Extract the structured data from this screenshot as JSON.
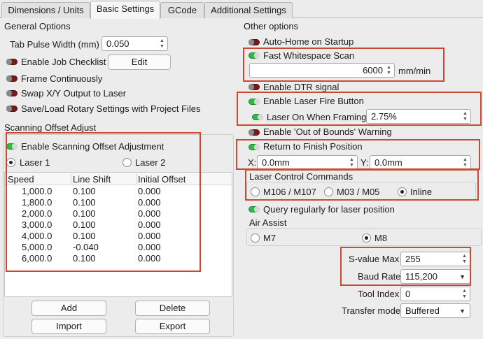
{
  "tabs": [
    {
      "label": "Dimensions / Units"
    },
    {
      "label": "Basic Settings"
    },
    {
      "label": "GCode"
    },
    {
      "label": "Additional Settings"
    }
  ],
  "general": {
    "title": "General Options",
    "tab_pulse_label": "Tab Pulse Width (mm)",
    "tab_pulse_value": "0.050",
    "job_checklist_label": "Enable Job Checklist",
    "edit_label": "Edit",
    "frame_continuously_label": "Frame Continuously",
    "swap_xy_label": "Swap X/Y Output to Laser",
    "rotary_label": "Save/Load Rotary Settings with Project Files"
  },
  "scanning": {
    "title": "Scanning Offset Adjust",
    "enable_label": "Enable Scanning Offset Adjustment",
    "laser1_label": "Laser 1",
    "laser2_label": "Laser 2",
    "columns": [
      "Speed",
      "Line Shift",
      "Initial Offset"
    ],
    "rows": [
      [
        "1,000.0",
        "0.100",
        "0.000"
      ],
      [
        "1,800.0",
        "0.100",
        "0.000"
      ],
      [
        "2,000.0",
        "0.100",
        "0.000"
      ],
      [
        "3,000.0",
        "0.100",
        "0.000"
      ],
      [
        "4,000.0",
        "0.100",
        "0.000"
      ],
      [
        "5,000.0",
        "-0.040",
        "0.000"
      ],
      [
        "6,000.0",
        "0.100",
        "0.000"
      ]
    ],
    "add_label": "Add",
    "delete_label": "Delete",
    "import_label": "Import",
    "export_label": "Export"
  },
  "other": {
    "title": "Other options",
    "auto_home_label": "Auto-Home on Startup",
    "fast_whitespace_label": "Fast Whitespace Scan",
    "whitespace_value": "6000",
    "whitespace_unit": "mm/min",
    "dtr_label": "Enable DTR signal",
    "laser_fire_label": "Enable Laser Fire Button",
    "laser_on_framing_label": "Laser On When Framing",
    "laser_on_framing_value": "2.75%",
    "out_of_bounds_label": "Enable 'Out of Bounds' Warning",
    "return_finish_label": "Return to Finish Position",
    "x_label": "X:",
    "x_value": "0.0mm",
    "y_label": "Y:",
    "y_value": "0.0mm",
    "laser_control_title": "Laser Control Commands",
    "m106_label": "M106 / M107",
    "m03_label": "M03 / M05",
    "inline_label": "Inline",
    "query_label": "Query regularly for laser position",
    "air_assist_title": "Air Assist",
    "m7_label": "M7",
    "m8_label": "M8",
    "svalue_label": "S-value Max",
    "svalue_value": "255",
    "baud_label": "Baud Rate",
    "baud_value": "115,200",
    "tool_index_label": "Tool Index",
    "tool_index_value": "0",
    "transfer_label": "Transfer mode",
    "transfer_value": "Buffered"
  },
  "colors": {
    "annotation_red": "#c84a35",
    "toggle_on": "#2fb84a",
    "toggle_off": "#7b1818"
  }
}
